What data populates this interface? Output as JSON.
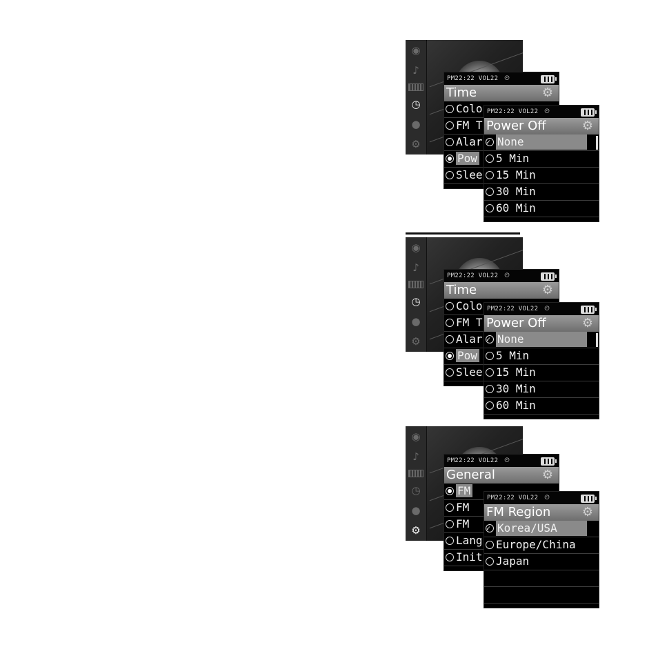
{
  "status": {
    "time": "PM22:22",
    "vol": "VOL22"
  },
  "screens": [
    {
      "back_title": "Time",
      "back_items": [
        "Colo",
        "FM T",
        "Alar",
        "Pow",
        "Slee"
      ],
      "front_title": "Power Off",
      "front_items": [
        "None",
        "5 Min",
        "15 Min",
        "30 Min",
        "60 Min"
      ]
    },
    {
      "back_title": "Time",
      "back_items": [
        "Colo",
        "FM T",
        "Alar",
        "Pow",
        "Slee"
      ],
      "front_title": "Power Off",
      "front_items": [
        "None",
        "5 Min",
        "15 Min",
        "30 Min",
        "60 Min"
      ]
    },
    {
      "back_title": "General",
      "back_items": [
        "FM",
        "FM",
        "FM",
        "Lang",
        "Init"
      ],
      "front_title": "FM Region",
      "front_items": [
        "Korea/USA",
        "Europe/China",
        "Japan",
        "",
        ""
      ]
    }
  ],
  "icons": [
    "disc-icon",
    "music-icon",
    "battery-icon",
    "clock-icon",
    "mic-icon",
    "settings-icon"
  ]
}
